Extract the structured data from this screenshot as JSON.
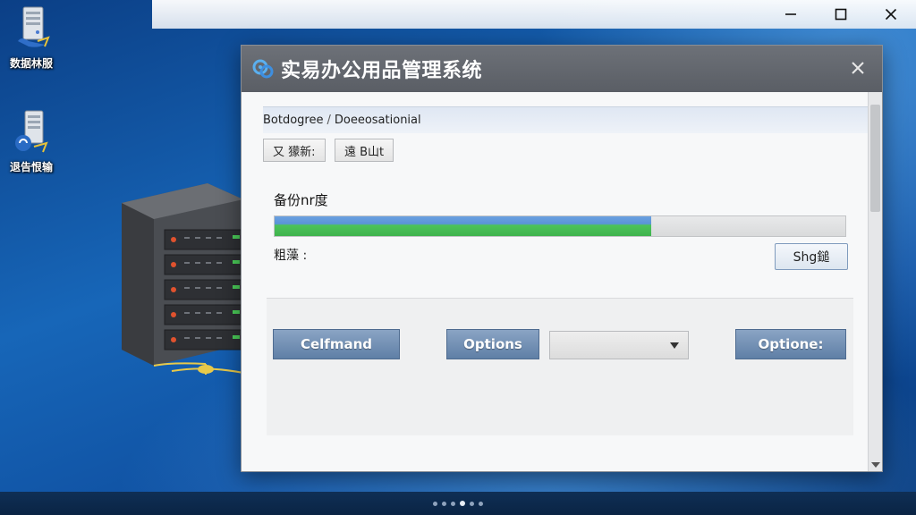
{
  "desktop": {
    "icons": [
      {
        "label": "数据林服"
      },
      {
        "label": "退告恨输"
      }
    ]
  },
  "window_controls": {
    "minimize": "minimize-icon",
    "maximize": "maximize-icon",
    "close": "close-icon"
  },
  "dialog": {
    "title": "实易办公用品管理系统",
    "breadcrumb": {
      "part1": "Botdogree",
      "separator": "/",
      "part2": "Doeeosationial"
    },
    "segment_buttons": [
      {
        "label": "又 獴新:"
      },
      {
        "label": "遠 B山t"
      }
    ],
    "progress": {
      "label": "备份nr度",
      "percent": 66
    },
    "status": {
      "label": "粗藻 :",
      "button_label": "Shg鎚"
    },
    "actions": {
      "command_label": "Celfmand",
      "options_label": "Options",
      "select_value": "",
      "options2_label": "Optione:"
    },
    "colors": {
      "title_bar": "#5f636a",
      "action_button": "#6f8db3",
      "progress_green": "#3fb34e",
      "progress_blue": "#5a94d8"
    }
  },
  "taskbar": {
    "dot_count": 6
  }
}
